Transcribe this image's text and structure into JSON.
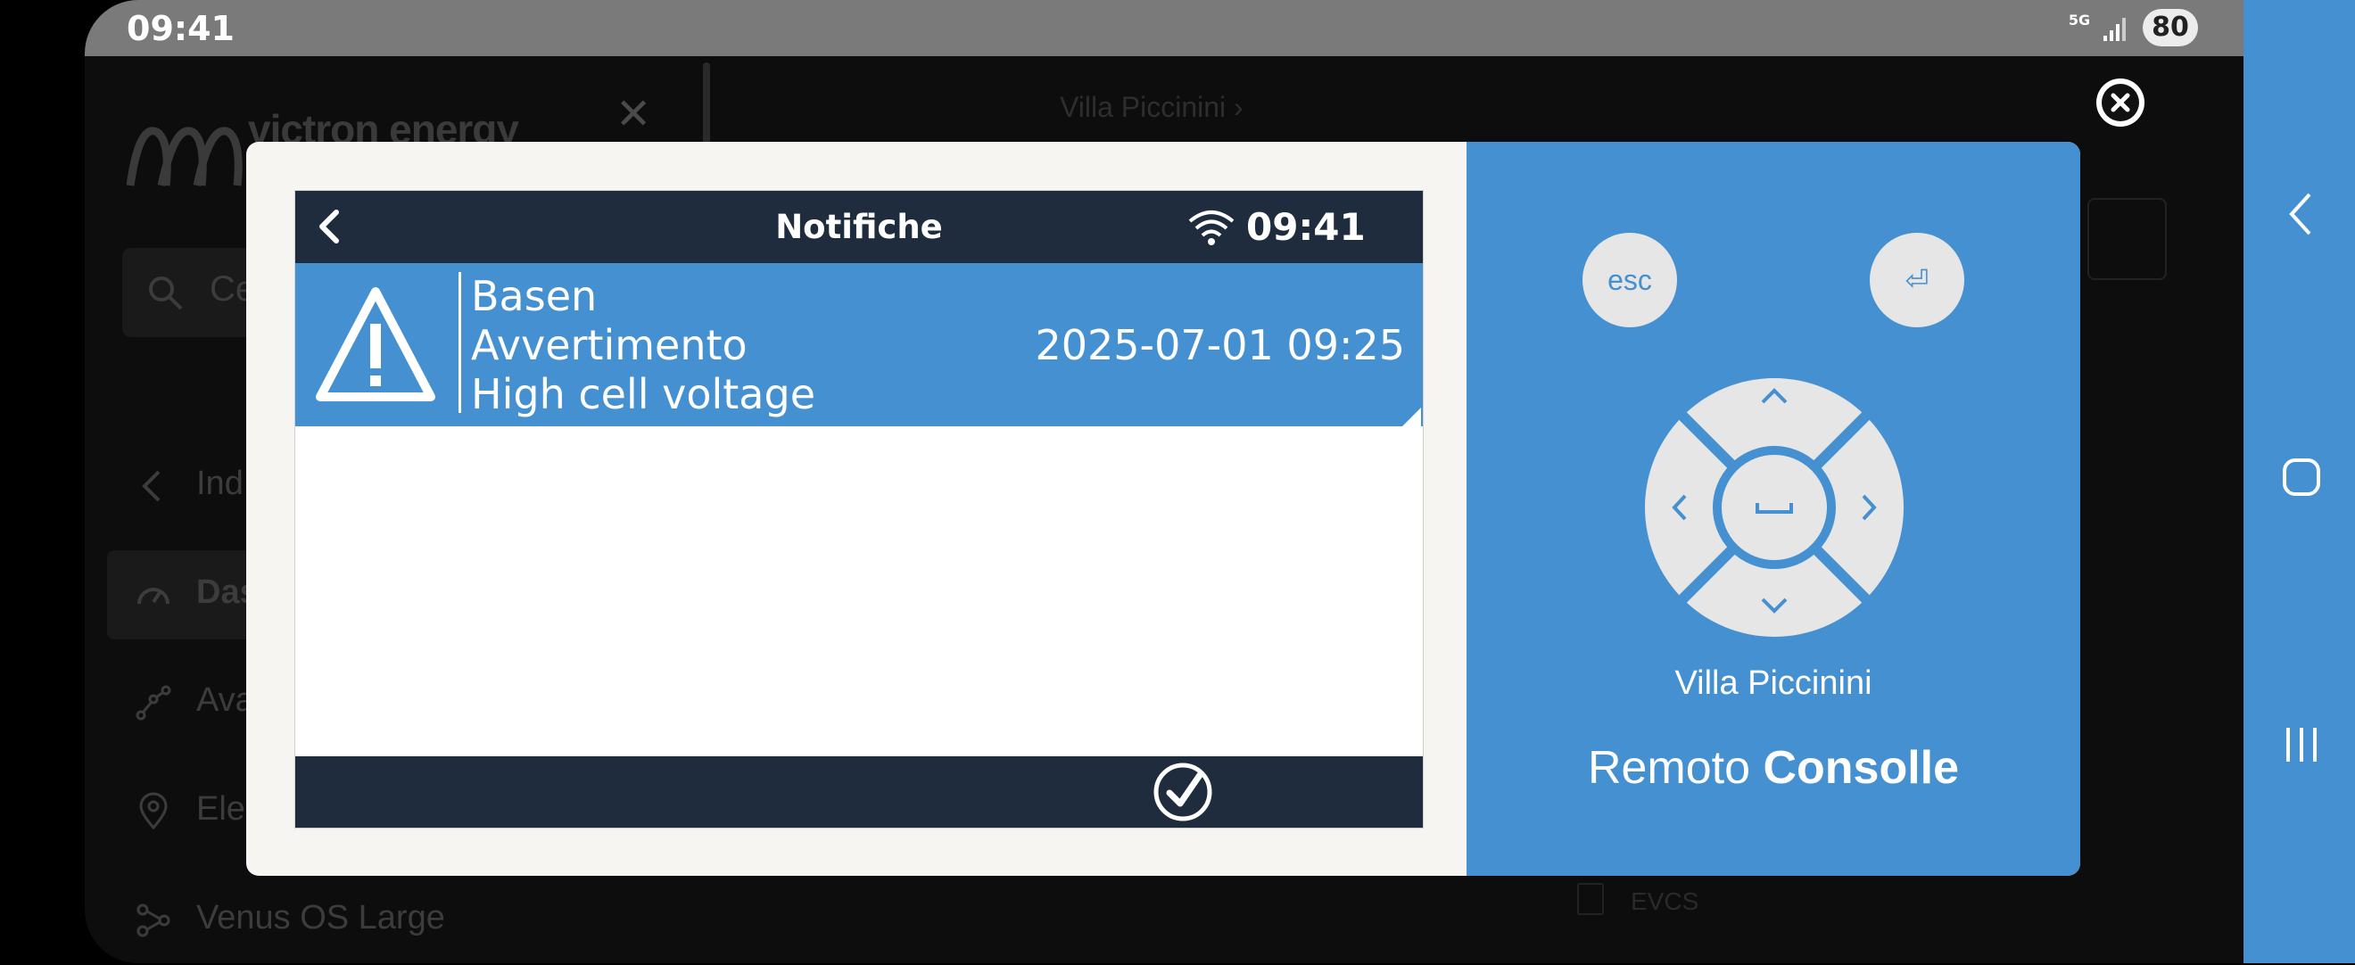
{
  "status_bar": {
    "time": "09:41",
    "network": "5G",
    "battery": "80"
  },
  "background_app": {
    "brand": "victron energy",
    "search_placeholder": "Ce",
    "nav_items": [
      {
        "label": "Ind",
        "icon": "chevron-left-icon"
      },
      {
        "label": "Das",
        "icon": "gauge-icon"
      },
      {
        "label": "Ava",
        "icon": "graph-icon"
      },
      {
        "label": "Ele",
        "icon": "location-icon"
      },
      {
        "label": "Venus OS Large",
        "icon": "nodes-icon"
      }
    ],
    "breadcrumb": "Villa Piccinini  ›",
    "evcs": "EVCS"
  },
  "remote_console": {
    "header_title": "Notifiche",
    "header_time": "09:41",
    "notification": {
      "line1": "Basen",
      "line2": "Avvertimento",
      "line3": "High cell voltage",
      "datetime": "2025-07-01 09:25"
    },
    "keys": {
      "esc": "esc",
      "enter": "⏎",
      "up": "^",
      "down": "v",
      "left": "<",
      "right": ">",
      "space": "⎵"
    },
    "site_name": "Villa Piccinini",
    "title_normal": "Remoto",
    "title_bold": "Consolle"
  },
  "colors": {
    "panel_blue": "#4590d0",
    "header_navy": "#1f2c3e",
    "dialog_bg": "#f7f5f1"
  }
}
